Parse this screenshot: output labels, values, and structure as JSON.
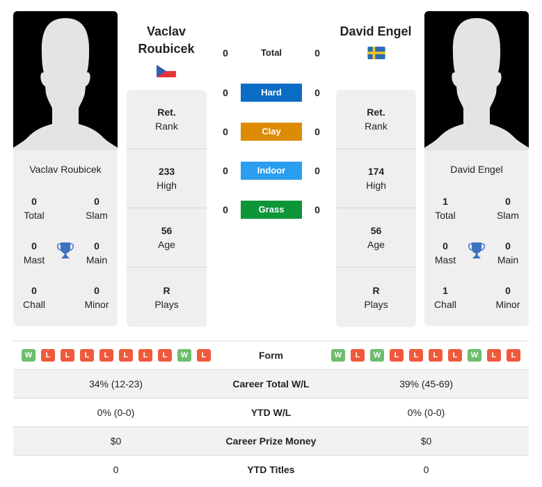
{
  "colors": {
    "hard": "#0a6cc4",
    "clay": "#de8b04",
    "indoor": "#2b9ef0",
    "grass": "#0c9638",
    "win": "#6ebd6e",
    "loss": "#ef5a3c",
    "trophy": "#3d71c2"
  },
  "player1": {
    "name_line1": "Vaclav",
    "name_line2": "Roubicek",
    "full_name": "Vaclav Roubicek",
    "country": "Czech Republic",
    "titles": {
      "total": "0",
      "total_label": "Total",
      "slam": "0",
      "slam_label": "Slam",
      "mast": "0",
      "mast_label": "Mast",
      "main": "0",
      "main_label": "Main",
      "chall": "0",
      "chall_label": "Chall",
      "minor": "0",
      "minor_label": "Minor"
    },
    "stats": [
      {
        "value": "Ret.",
        "label": "Rank"
      },
      {
        "value": "233",
        "label": "High"
      },
      {
        "value": "56",
        "label": "Age"
      },
      {
        "value": "R",
        "label": "Plays"
      }
    ],
    "form": [
      "W",
      "L",
      "L",
      "L",
      "L",
      "L",
      "L",
      "L",
      "W",
      "L"
    ]
  },
  "player2": {
    "name": "David Engel",
    "full_name": "David Engel",
    "country": "Sweden",
    "titles": {
      "total": "1",
      "total_label": "Total",
      "slam": "0",
      "slam_label": "Slam",
      "mast": "0",
      "mast_label": "Mast",
      "main": "0",
      "main_label": "Main",
      "chall": "1",
      "chall_label": "Chall",
      "minor": "0",
      "minor_label": "Minor"
    },
    "stats": [
      {
        "value": "Ret.",
        "label": "Rank"
      },
      {
        "value": "174",
        "label": "High"
      },
      {
        "value": "56",
        "label": "Age"
      },
      {
        "value": "R",
        "label": "Plays"
      }
    ],
    "form": [
      "W",
      "L",
      "W",
      "L",
      "L",
      "L",
      "L",
      "W",
      "L",
      "L"
    ]
  },
  "h2h": [
    {
      "label": "Total",
      "p1": "0",
      "p2": "0"
    },
    {
      "label": "Hard",
      "p1": "0",
      "p2": "0"
    },
    {
      "label": "Clay",
      "p1": "0",
      "p2": "0"
    },
    {
      "label": "Indoor",
      "p1": "0",
      "p2": "0"
    },
    {
      "label": "Grass",
      "p1": "0",
      "p2": "0"
    }
  ],
  "table": {
    "form_label": "Form",
    "rows": [
      {
        "label": "Career Total W/L",
        "p1": "34% (12-23)",
        "p2": "39% (45-69)"
      },
      {
        "label": "YTD W/L",
        "p1": "0% (0-0)",
        "p2": "0% (0-0)"
      },
      {
        "label": "Career Prize Money",
        "p1": "$0",
        "p2": "$0"
      },
      {
        "label": "YTD Titles",
        "p1": "0",
        "p2": "0"
      }
    ]
  }
}
